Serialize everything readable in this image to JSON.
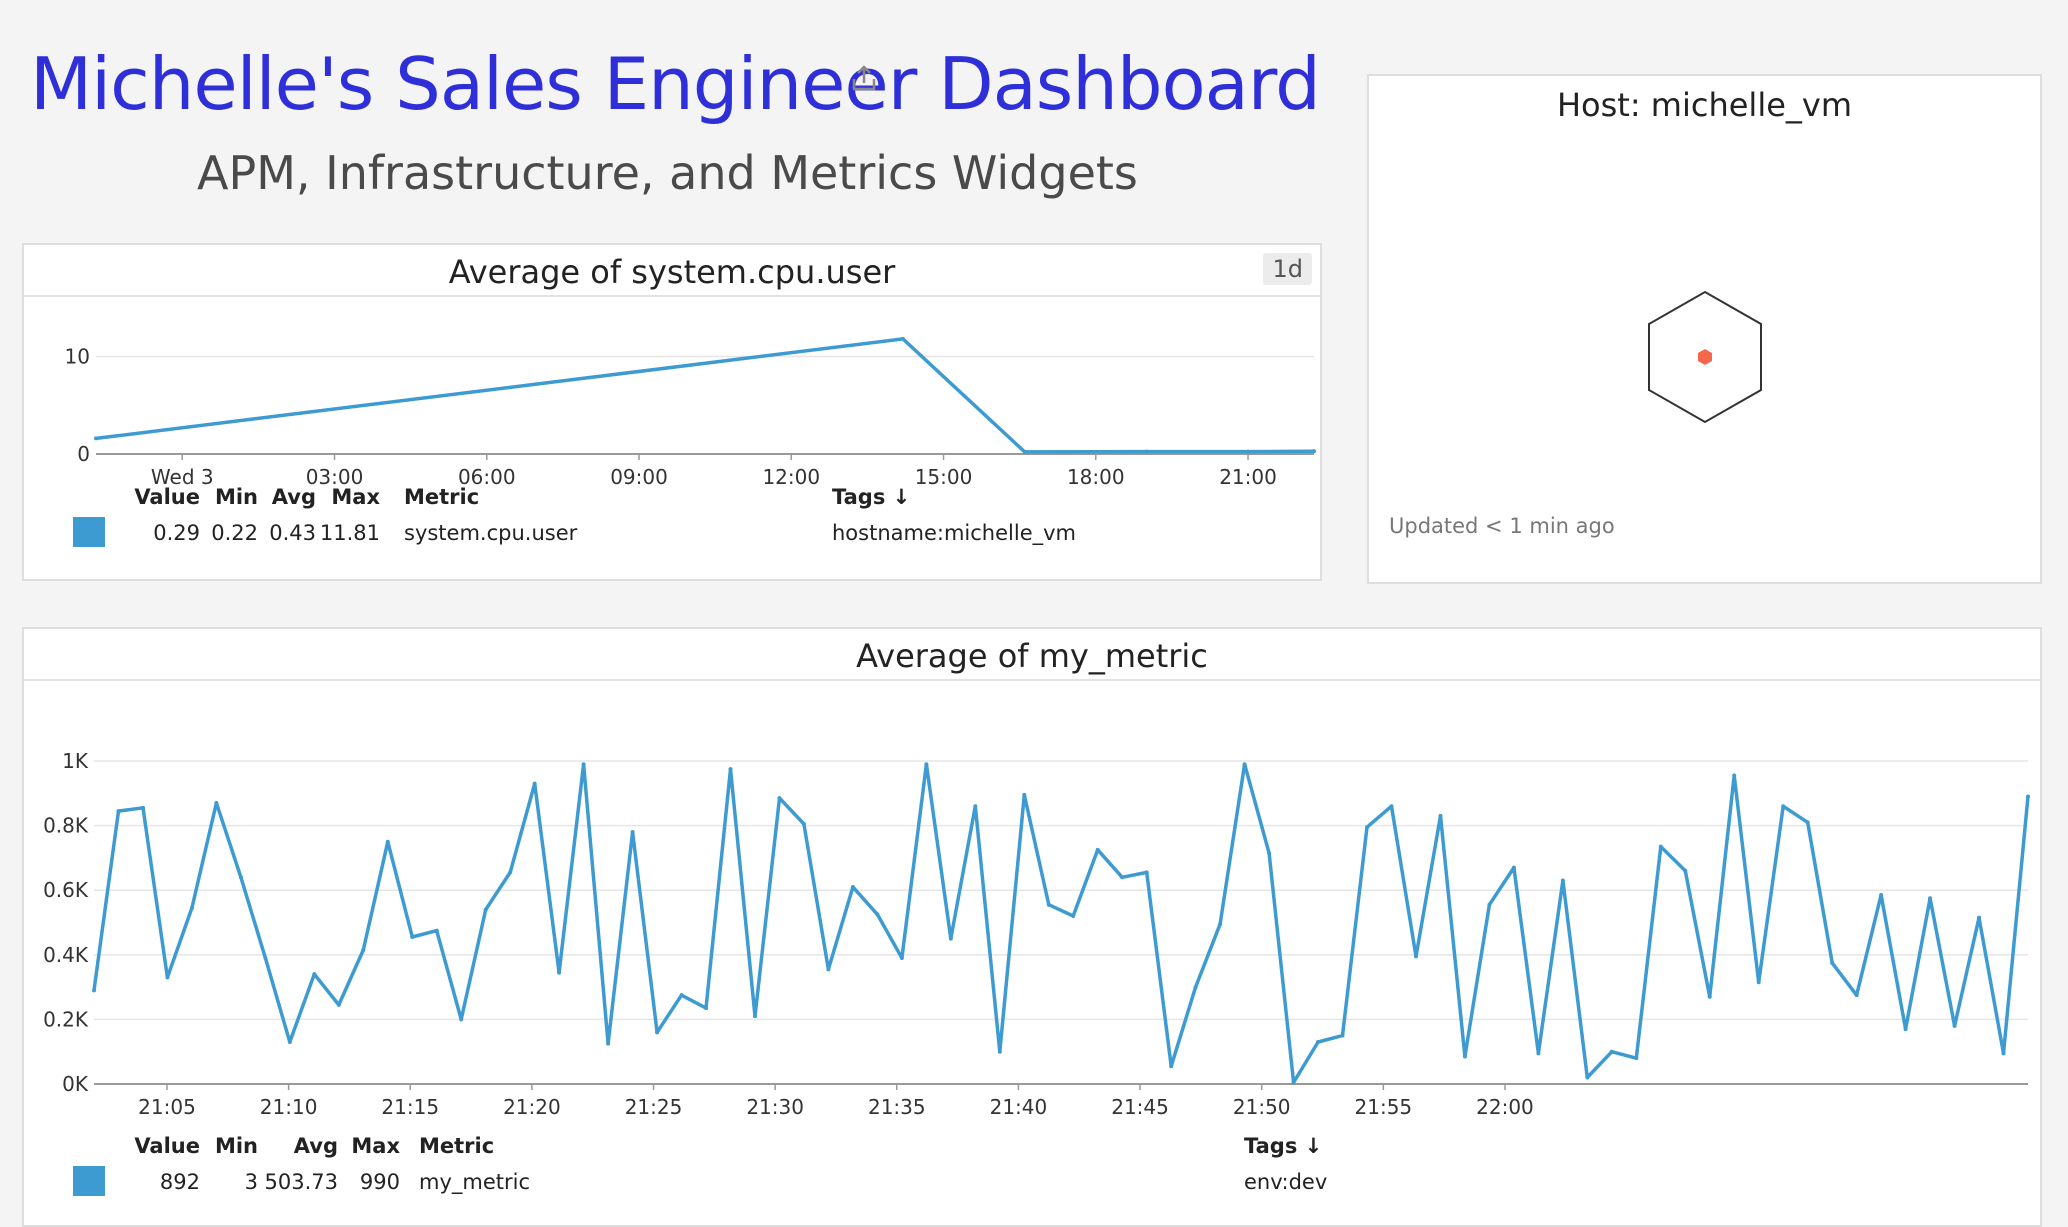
{
  "dashboard": {
    "title": "Michelle's Sales Engineer Dashboard",
    "subtitle": "APM, Infrastructure, and Metrics Widgets"
  },
  "colors": {
    "accent": "#2f2fd9",
    "series": "#3d9bd2",
    "host_dot": "#f4684c"
  },
  "icons": {
    "share": "share-icon"
  },
  "cpu_widget": {
    "title": "Average of system.cpu.user",
    "timeframe": "1d",
    "legend_headers": {
      "value": "Value",
      "min": "Min",
      "avg": "Avg",
      "max": "Max",
      "metric": "Metric",
      "tags": "Tags ↓"
    },
    "legend_row": {
      "value": "0.29",
      "min": "0.22",
      "avg": "0.43",
      "max": "11.81",
      "metric": "system.cpu.user",
      "tags": "hostname:michelle_vm"
    }
  },
  "host_widget": {
    "title": "Host: michelle_vm",
    "updated": "Updated < 1 min ago"
  },
  "metric_widget": {
    "title": "Average of my_metric",
    "legend_headers": {
      "value": "Value",
      "min": "Min",
      "avg": "Avg",
      "max": "Max",
      "metric": "Metric",
      "tags": "Tags ↓"
    },
    "legend_row": {
      "value": "892",
      "min": "3",
      "avg": "503.73",
      "max": "990",
      "metric": "my_metric",
      "tags": "env:dev"
    }
  },
  "chart_data": [
    {
      "type": "line",
      "title": "Average of system.cpu.user",
      "ylim": [
        0,
        12
      ],
      "yticks": [
        0,
        10
      ],
      "ytick_labels": [
        "0",
        "10"
      ],
      "xlim_hours": [
        -1.7,
        22.3
      ],
      "xticks": [
        0,
        3,
        6,
        9,
        12,
        15,
        18,
        21
      ],
      "xtick_labels": [
        "Wed 3",
        "03:00",
        "06:00",
        "09:00",
        "12:00",
        "15:00",
        "18:00",
        "21:00"
      ],
      "series": [
        {
          "x": [
            -1.7,
            14.2,
            16.6,
            19,
            21,
            22.3
          ],
          "values": [
            1.6,
            11.81,
            0.22,
            0.25,
            0.25,
            0.29
          ]
        }
      ]
    },
    {
      "type": "line",
      "title": "Average of my_metric",
      "ylim": [
        0,
        1000
      ],
      "yticks": [
        0,
        200,
        400,
        600,
        800,
        1000
      ],
      "ytick_labels": [
        "0K",
        "0.2K",
        "0.4K",
        "0.6K",
        "0.8K",
        "1K"
      ],
      "xlim_minutes": [
        1262,
        1341.5
      ],
      "xticks": [
        1265,
        1270,
        1275,
        1280,
        1285,
        1290,
        1295,
        1300,
        1305,
        1310,
        1315,
        1320,
        1325,
        1330,
        1335,
        1340
      ],
      "xtick_labels": [
        "21:05",
        "21:10",
        "21:15",
        "21:20",
        "21:25",
        "21:30",
        "21:35",
        "21:40",
        "21:45",
        "21:50",
        "21:55",
        "22:00"
      ],
      "series": [
        {
          "values": [
            290,
            845,
            855,
            330,
            545,
            870,
            640,
            390,
            130,
            340,
            245,
            415,
            750,
            455,
            475,
            200,
            540,
            655,
            930,
            345,
            990,
            125,
            780,
            160,
            275,
            235,
            975,
            210,
            885,
            805,
            355,
            610,
            525,
            390,
            990,
            450,
            860,
            100,
            895,
            555,
            520,
            725,
            640,
            655,
            55,
            300,
            495,
            990,
            715,
            5,
            130,
            150,
            795,
            860,
            395,
            830,
            85,
            555,
            670,
            95,
            630,
            20,
            100,
            80,
            735,
            660,
            270,
            955,
            315,
            860,
            810,
            375,
            275,
            585,
            170,
            575,
            180,
            515,
            95,
            890
          ]
        }
      ]
    }
  ]
}
